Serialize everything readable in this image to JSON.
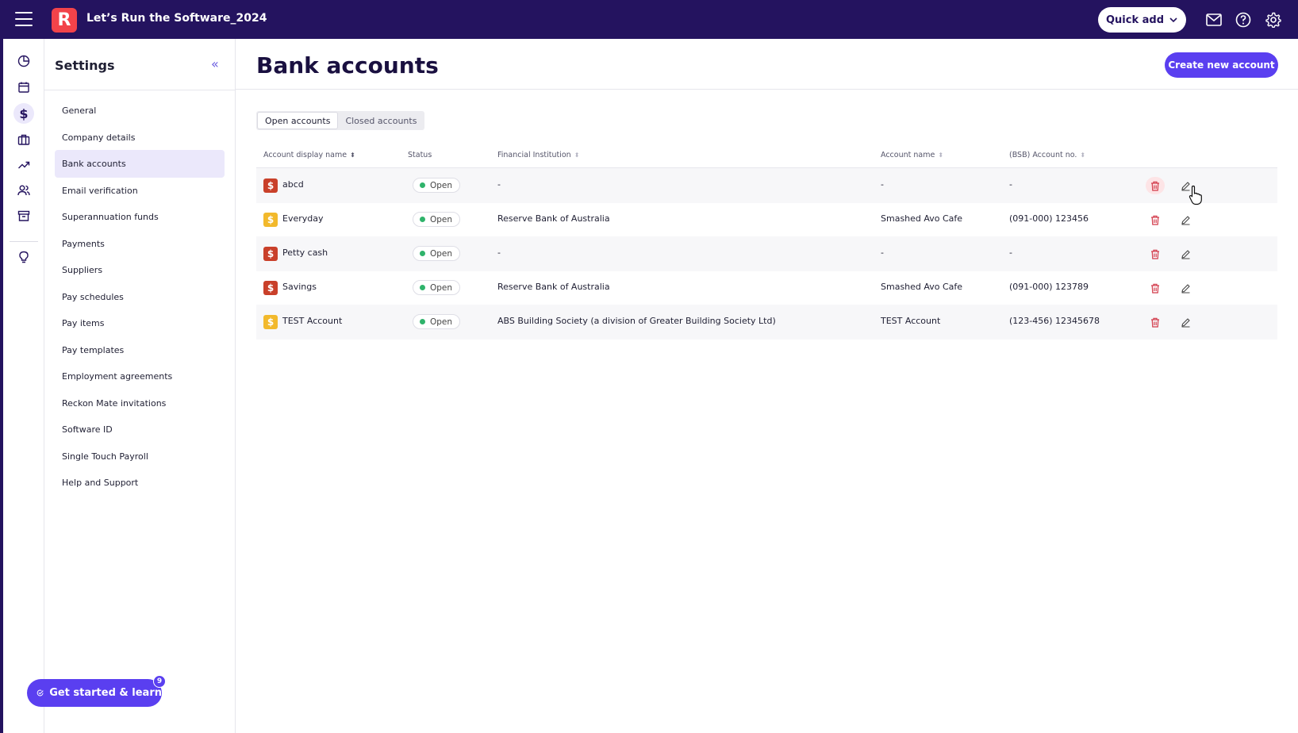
{
  "app": {
    "title": "Let’s Run the Software_2024",
    "logo_letter": "R",
    "quick_add_label": "Quick add"
  },
  "settings": {
    "title": "Settings",
    "collapse_glyph": "«",
    "items": [
      {
        "label": "General"
      },
      {
        "label": "Company details"
      },
      {
        "label": "Bank accounts",
        "active": true
      },
      {
        "label": "Email verification"
      },
      {
        "label": "Superannuation funds"
      },
      {
        "label": "Payments"
      },
      {
        "label": "Suppliers"
      },
      {
        "label": "Pay schedules"
      },
      {
        "label": "Pay items"
      },
      {
        "label": "Pay templates"
      },
      {
        "label": "Employment agreements"
      },
      {
        "label": "Reckon Mate invitations"
      },
      {
        "label": "Software ID"
      },
      {
        "label": "Single Touch Payroll"
      },
      {
        "label": "Help and Support"
      }
    ]
  },
  "get_started": {
    "label": "Get started & learn",
    "badge": "9"
  },
  "main": {
    "title": "Bank accounts",
    "create_button": "Create new account",
    "tabs": [
      {
        "label": "Open accounts",
        "active": true
      },
      {
        "label": "Closed accounts"
      }
    ],
    "columns": [
      "Account display name",
      "Status",
      "Financial Institution",
      "Account name",
      "(BSB) Account no."
    ],
    "rows": [
      {
        "name": "abcd",
        "status": "Open",
        "institution": "-",
        "account_name": "-",
        "account_no": "-",
        "icon_color": "#c9402a"
      },
      {
        "name": "Everyday",
        "status": "Open",
        "institution": "Reserve Bank of Australia",
        "account_name": "Smashed Avo Cafe",
        "account_no": "(091-000) 123456",
        "icon_color": "#f2b92c"
      },
      {
        "name": "Petty cash",
        "status": "Open",
        "institution": "-",
        "account_name": "-",
        "account_no": "-",
        "icon_color": "#c9402a"
      },
      {
        "name": "Savings",
        "status": "Open",
        "institution": "Reserve Bank of Australia",
        "account_name": "Smashed Avo Cafe",
        "account_no": "(091-000) 123789",
        "icon_color": "#c9402a"
      },
      {
        "name": "TEST Account",
        "status": "Open",
        "institution": "ABS Building Society (a division of Greater Building Society Ltd)",
        "account_name": "TEST Account",
        "account_no": "(123-456) 12345678",
        "icon_color": "#f2b92c"
      }
    ]
  },
  "colors": {
    "topbar": "#24135f",
    "accent": "#5a3ff0",
    "brand": "#f2434a",
    "status_open": "#2fb36b",
    "delete": "#d23a4a"
  }
}
